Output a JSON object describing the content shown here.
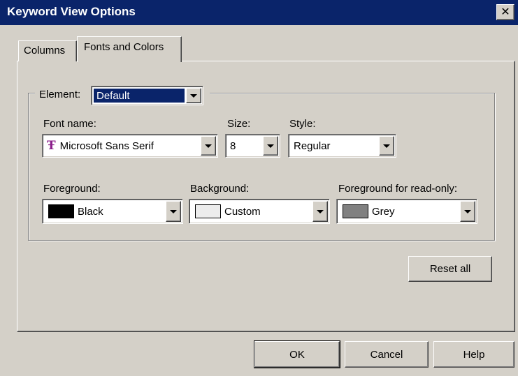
{
  "window": {
    "title": "Keyword View Options",
    "close_glyph": "✕"
  },
  "tabs": [
    {
      "label": "Columns",
      "active": false
    },
    {
      "label": "Fonts and Colors",
      "active": true
    }
  ],
  "element": {
    "label": "Element:",
    "value": "Default"
  },
  "font": {
    "name_label": "Font name:",
    "name_value": "Microsoft Sans Serif",
    "name_icon": "truetype-font-icon",
    "size_label": "Size:",
    "size_value": "8",
    "style_label": "Style:",
    "style_value": "Regular"
  },
  "colors": {
    "foreground_label": "Foreground:",
    "foreground_value": "Black",
    "foreground_color": "#000000",
    "background_label": "Background:",
    "background_value": "Custom",
    "background_color": "#ececec",
    "readonly_label": "Foreground for read-only:",
    "readonly_value": "Grey",
    "readonly_color": "#808080"
  },
  "buttons": {
    "reset_all": "Reset all",
    "ok": "OK",
    "cancel": "Cancel",
    "help": "Help"
  }
}
